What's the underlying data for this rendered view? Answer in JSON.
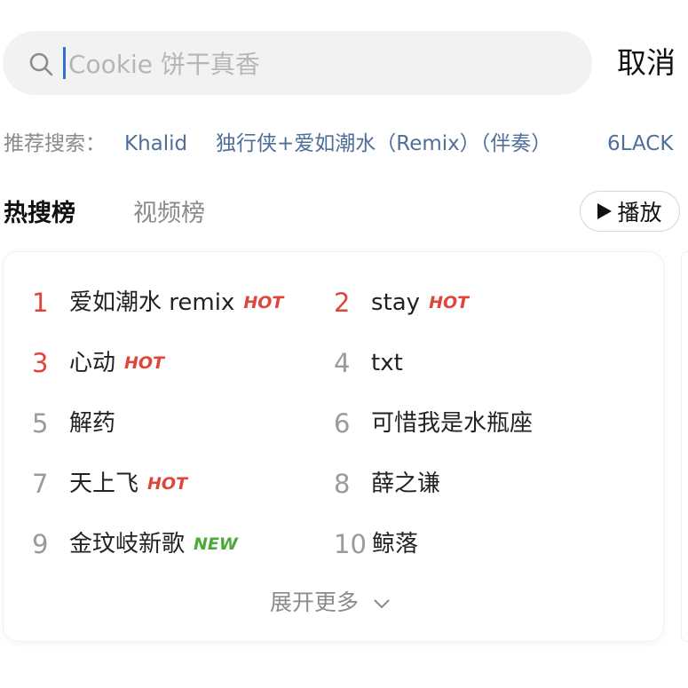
{
  "search": {
    "placeholder": "Cookie 饼干真香",
    "cancel_label": "取消"
  },
  "recommend": {
    "prefix": "推荐搜索：",
    "items": [
      "Khalid",
      "独行侠+爱如潮水（Remix）（伴奏）",
      "6LACK"
    ]
  },
  "tabs": {
    "items": [
      "热搜榜",
      "视频榜"
    ],
    "active": "热搜榜",
    "play_label": "播放"
  },
  "hot_list": {
    "items": [
      {
        "rank": "1",
        "title": "爱如潮水 remix",
        "badge": "HOT"
      },
      {
        "rank": "2",
        "title": "stay",
        "badge": "HOT"
      },
      {
        "rank": "3",
        "title": "心动",
        "badge": "HOT"
      },
      {
        "rank": "4",
        "title": "txt",
        "badge": ""
      },
      {
        "rank": "5",
        "title": "解药",
        "badge": ""
      },
      {
        "rank": "6",
        "title": "可惜我是水瓶座",
        "badge": ""
      },
      {
        "rank": "7",
        "title": "天上飞",
        "badge": "HOT"
      },
      {
        "rank": "8",
        "title": "薛之谦",
        "badge": ""
      },
      {
        "rank": "9",
        "title": "金玟岐新歌",
        "badge": "NEW"
      },
      {
        "rank": "10",
        "title": "鲸落",
        "badge": ""
      }
    ],
    "expand_label": "展开更多"
  },
  "colors": {
    "accent_red": "#e0453c",
    "new_green": "#4caa38",
    "link_blue": "#4f6f98"
  },
  "icons": {
    "search": "search-icon",
    "play": "play-icon",
    "expand": "chevron-down-icon"
  }
}
